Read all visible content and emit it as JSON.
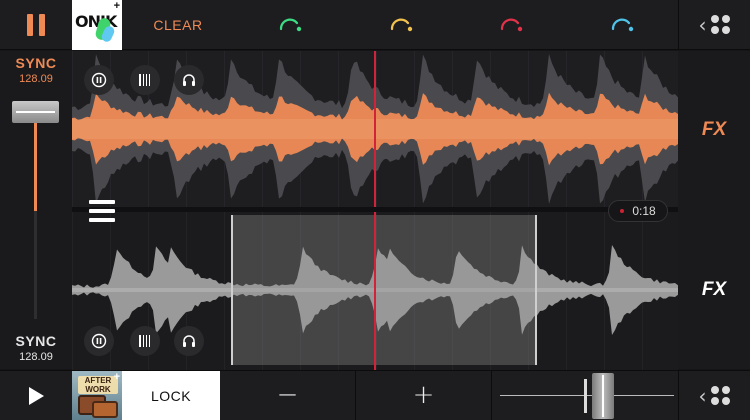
{
  "top_bar": {
    "cover_text": "ONIK",
    "add_label": "+",
    "clear_label": "CLEAR",
    "knob_colors": [
      "#3ddc84",
      "#f2c14e",
      "#e2324a",
      "#4fc3e8"
    ]
  },
  "deck_a": {
    "sync_label": "SYNC",
    "bpm": "128.09",
    "fx_label": "FX",
    "waveform_color": "#ef8a55"
  },
  "deck_b": {
    "sync_label": "SYNC",
    "bpm": "128.09",
    "fx_label": "FX",
    "time_display": "0:18",
    "waveform_color": "#9a9a9a"
  },
  "bottom_bar": {
    "cover_text": "AFTER WORK",
    "add_label": "+",
    "lock_label": "LOCK",
    "minus_label": "−",
    "plus_label": "+"
  },
  "colors": {
    "accent": "#ef8a55",
    "playhead": "#d1243a",
    "background": "#151517"
  },
  "icons": {
    "pause": "pause-icon",
    "play": "play-icon",
    "menu": "grid-menu-icon",
    "headphones": "headphones-icon",
    "cue_pause": "circle-pause-icon",
    "beatgrid": "beatgrid-icon",
    "hamburger": "hamburger-icon"
  }
}
